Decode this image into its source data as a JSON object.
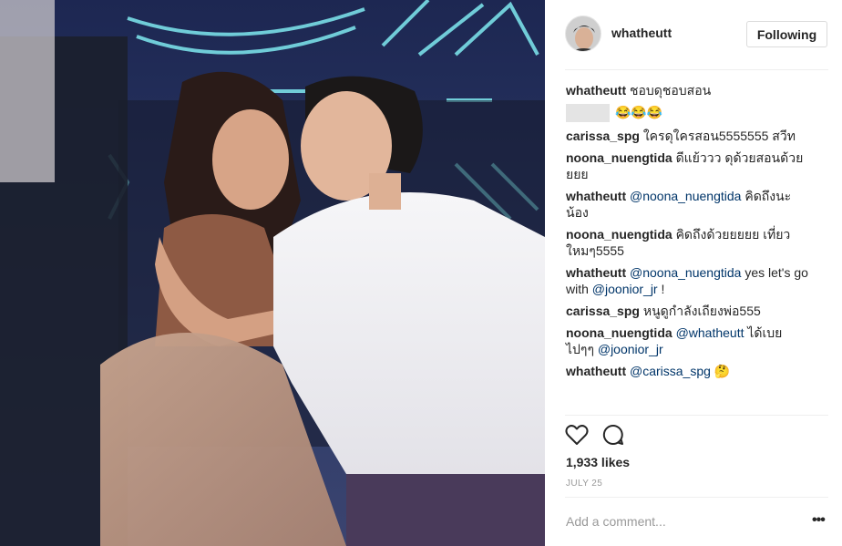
{
  "post": {
    "username": "whatheutt",
    "follow_label": "Following"
  },
  "comments": [
    {
      "user": "whatheutt",
      "text": "ชอบดุชอบสอน"
    },
    {
      "user": "",
      "text": "😂😂😂"
    },
    {
      "user": "carissa_spg",
      "text": "ใครดุใครสอน5555555 สวีท"
    },
    {
      "user": "noona_nuengtida",
      "text": "ดีแย้ววว ดุด้วยสอนด้วยยยย"
    },
    {
      "user": "whatheutt",
      "mention": "@noona_nuengtida",
      "text": "คิดถึงนะน้อง"
    },
    {
      "user": "noona_nuengtida",
      "text": "คิดถึงด้วยยยยย เที่ยว ใหมๆ5555"
    },
    {
      "user": "whatheutt",
      "mention": "@noona_nuengtida",
      "text": "yes let's go with",
      "mention2": "@joonior_jr",
      "text2": "!"
    },
    {
      "user": "carissa_spg",
      "text": "หนูดูกำลังเถียงพ่อ555"
    },
    {
      "user": "noona_nuengtida",
      "mention": "@whatheutt",
      "text": "ได้เบย ไปๆๆ",
      "mention2": "@joonior_jr"
    },
    {
      "user": "whatheutt",
      "mention": "@carissa_spg",
      "text": "🤔"
    }
  ],
  "likes_text": "1,933 likes",
  "date_text": "JULY 25",
  "add_comment_placeholder": "Add a comment...",
  "more_text": "•••",
  "icons": {
    "like": "heart-icon",
    "comment": "comment-icon"
  }
}
